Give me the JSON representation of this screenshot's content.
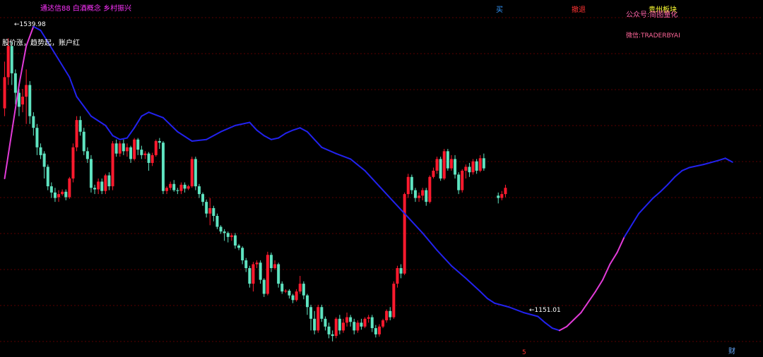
{
  "annotations": {
    "header_tags": "通达信88 白酒概念 乡村振兴",
    "indicator_note": "股价涨，趋势起，账户红",
    "high_label": "1539.98",
    "low_label": "1151.01",
    "buy_marker": "买",
    "withdraw_marker": "撤退",
    "sector": "贵州板块",
    "public_account": "公众号:简图量化",
    "wechat": "微信:TRADERBYAI",
    "bottom_marker_5": "5",
    "bottom_marker_cai": "财"
  },
  "colors": {
    "background": "#000000",
    "up_candle": "#ff1a2e",
    "down_candle": "#5fe3c0",
    "trend_line_blue": "#2222ee",
    "trend_line_magenta": "#e23bd8",
    "grid": "#5a0000"
  },
  "chart_data": {
    "type": "candlestick",
    "y_range": [
      1140,
      1580
    ],
    "high": 1539.98,
    "low": 1151.01,
    "candles": [
      [
        1450,
        1490,
        1510,
        1440
      ],
      [
        1490,
        1530,
        1539.98,
        1480
      ],
      [
        1530,
        1495,
        1535,
        1480
      ],
      [
        1495,
        1470,
        1500,
        1455
      ],
      [
        1470,
        1452,
        1475,
        1440
      ],
      [
        1455,
        1465,
        1475,
        1445
      ],
      [
        1465,
        1480,
        1500,
        1430
      ],
      [
        1480,
        1440,
        1485,
        1430
      ],
      [
        1440,
        1425,
        1445,
        1415
      ],
      [
        1425,
        1400,
        1430,
        1390
      ],
      [
        1400,
        1390,
        1405,
        1385
      ],
      [
        1392,
        1375,
        1395,
        1360
      ],
      [
        1375,
        1350,
        1378,
        1345
      ],
      [
        1350,
        1342,
        1355,
        1335
      ],
      [
        1342,
        1335,
        1348,
        1330
      ],
      [
        1336,
        1340,
        1345,
        1330
      ],
      [
        1340,
        1343,
        1346,
        1338
      ],
      [
        1343,
        1336,
        1346,
        1332
      ],
      [
        1336,
        1360,
        1362,
        1334
      ],
      [
        1360,
        1400,
        1405,
        1355
      ],
      [
        1400,
        1435,
        1440,
        1395
      ],
      [
        1435,
        1420,
        1440,
        1415
      ],
      [
        1420,
        1395,
        1425,
        1390
      ],
      [
        1395,
        1385,
        1400,
        1380
      ],
      [
        1385,
        1348,
        1390,
        1342
      ],
      [
        1348,
        1346,
        1352,
        1340
      ],
      [
        1346,
        1356,
        1360,
        1340
      ],
      [
        1356,
        1344,
        1360,
        1340
      ],
      [
        1344,
        1364,
        1366,
        1340
      ],
      [
        1364,
        1350,
        1368,
        1345
      ],
      [
        1350,
        1405,
        1408,
        1345
      ],
      [
        1405,
        1392,
        1410,
        1388
      ],
      [
        1392,
        1405,
        1408,
        1388
      ],
      [
        1405,
        1395,
        1410,
        1390
      ],
      [
        1395,
        1400,
        1405,
        1388
      ],
      [
        1400,
        1385,
        1402,
        1380
      ],
      [
        1385,
        1410,
        1412,
        1383
      ],
      [
        1410,
        1397,
        1412,
        1390
      ],
      [
        1397,
        1390,
        1402,
        1385
      ],
      [
        1390,
        1392,
        1395,
        1385
      ],
      [
        1392,
        1380,
        1394,
        1370
      ],
      [
        1380,
        1390,
        1393,
        1376
      ],
      [
        1390,
        1408,
        1410,
        1388
      ],
      [
        1408,
        1406,
        1412,
        1398
      ],
      [
        1406,
        1344,
        1408,
        1340
      ],
      [
        1344,
        1348,
        1350,
        1340
      ],
      [
        1348,
        1353,
        1356,
        1345
      ],
      [
        1353,
        1345,
        1358,
        1343
      ],
      [
        1345,
        1344,
        1348,
        1340
      ],
      [
        1344,
        1352,
        1355,
        1340
      ],
      [
        1352,
        1347,
        1355,
        1342
      ],
      [
        1347,
        1350,
        1352,
        1345
      ],
      [
        1350,
        1385,
        1388,
        1348
      ],
      [
        1385,
        1350,
        1388,
        1345
      ],
      [
        1350,
        1340,
        1353,
        1335
      ],
      [
        1340,
        1330,
        1342,
        1325
      ],
      [
        1330,
        1315,
        1333,
        1310
      ],
      [
        1315,
        1322,
        1335,
        1300
      ],
      [
        1322,
        1312,
        1325,
        1305
      ],
      [
        1312,
        1298,
        1315,
        1295
      ],
      [
        1298,
        1292,
        1300,
        1289
      ],
      [
        1292,
        1290,
        1295,
        1280
      ],
      [
        1290,
        1285,
        1292,
        1278
      ],
      [
        1285,
        1287,
        1290,
        1280
      ],
      [
        1287,
        1274,
        1290,
        1270
      ],
      [
        1274,
        1271,
        1276,
        1268
      ],
      [
        1271,
        1255,
        1273,
        1250
      ],
      [
        1255,
        1245,
        1258,
        1240
      ],
      [
        1245,
        1225,
        1248,
        1220
      ],
      [
        1225,
        1250,
        1253,
        1215
      ],
      [
        1250,
        1252,
        1255,
        1245
      ],
      [
        1252,
        1230,
        1255,
        1225
      ],
      [
        1230,
        1212,
        1232,
        1208
      ],
      [
        1212,
        1262,
        1266,
        1210
      ],
      [
        1262,
        1245,
        1265,
        1240
      ],
      [
        1245,
        1250,
        1255,
        1243
      ],
      [
        1250,
        1225,
        1252,
        1220
      ],
      [
        1225,
        1215,
        1228,
        1212
      ],
      [
        1215,
        1216,
        1218,
        1213
      ],
      [
        1216,
        1210,
        1218,
        1206
      ],
      [
        1210,
        1204,
        1212,
        1200
      ],
      [
        1204,
        1215,
        1218,
        1202
      ],
      [
        1215,
        1225,
        1235,
        1212
      ],
      [
        1225,
        1210,
        1228,
        1205
      ],
      [
        1210,
        1195,
        1212,
        1185
      ],
      [
        1195,
        1180,
        1198,
        1165
      ],
      [
        1180,
        1165,
        1190,
        1160
      ],
      [
        1165,
        1195,
        1198,
        1162
      ],
      [
        1195,
        1180,
        1198,
        1176
      ],
      [
        1180,
        1170,
        1183,
        1165
      ],
      [
        1170,
        1160,
        1175,
        1155
      ],
      [
        1160,
        1158,
        1165,
        1151.01
      ],
      [
        1158,
        1180,
        1182,
        1155
      ],
      [
        1180,
        1165,
        1185,
        1160
      ],
      [
        1165,
        1175,
        1180,
        1162
      ],
      [
        1175,
        1182,
        1188,
        1170
      ],
      [
        1182,
        1176,
        1185,
        1170
      ],
      [
        1176,
        1165,
        1180,
        1160
      ],
      [
        1165,
        1175,
        1178,
        1162
      ],
      [
        1175,
        1170,
        1180,
        1166
      ],
      [
        1170,
        1180,
        1182,
        1168
      ],
      [
        1180,
        1182,
        1185,
        1175
      ],
      [
        1182,
        1168,
        1185,
        1163
      ],
      [
        1168,
        1160,
        1172,
        1156
      ],
      [
        1160,
        1170,
        1173,
        1157
      ],
      [
        1170,
        1178,
        1180,
        1168
      ],
      [
        1178,
        1190,
        1192,
        1175
      ],
      [
        1190,
        1182,
        1195,
        1178
      ],
      [
        1182,
        1225,
        1228,
        1180
      ],
      [
        1225,
        1245,
        1248,
        1220
      ],
      [
        1245,
        1238,
        1250,
        1232
      ],
      [
        1238,
        1340,
        1342,
        1236
      ],
      [
        1340,
        1362,
        1366,
        1335
      ],
      [
        1362,
        1345,
        1365,
        1340
      ],
      [
        1345,
        1335,
        1348,
        1330
      ],
      [
        1335,
        1338,
        1342,
        1330
      ],
      [
        1338,
        1345,
        1348,
        1332
      ],
      [
        1345,
        1330,
        1348,
        1325
      ],
      [
        1330,
        1362,
        1364,
        1328
      ],
      [
        1362,
        1370,
        1374,
        1360
      ],
      [
        1370,
        1385,
        1388,
        1366
      ],
      [
        1385,
        1360,
        1388,
        1357
      ],
      [
        1360,
        1395,
        1398,
        1358
      ],
      [
        1395,
        1373,
        1398,
        1370
      ],
      [
        1373,
        1385,
        1390,
        1370
      ],
      [
        1385,
        1365,
        1390,
        1360
      ],
      [
        1365,
        1345,
        1368,
        1340
      ],
      [
        1345,
        1370,
        1372,
        1342
      ],
      [
        1370,
        1375,
        1378,
        1360
      ],
      [
        1375,
        1368,
        1380,
        1362
      ],
      [
        1368,
        1382,
        1385,
        1365
      ],
      [
        1382,
        1370,
        1385,
        1366
      ],
      [
        1370,
        1386,
        1390,
        1368
      ],
      [
        1386,
        1373,
        1392,
        1370
      ],
      null,
      null,
      null,
      [
        1338,
        1335,
        1342,
        1328
      ],
      [
        1335,
        1340,
        1344,
        1332
      ],
      [
        1340,
        1348,
        1352,
        1336
      ]
    ],
    "trend_line": [
      [
        0,
        1360
      ],
      [
        2,
        1420
      ],
      [
        4,
        1480
      ],
      [
        6,
        1530
      ],
      [
        8,
        1555
      ],
      [
        10,
        1550
      ],
      [
        14,
        1520
      ],
      [
        18,
        1490
      ],
      [
        20,
        1465
      ],
      [
        24,
        1440
      ],
      [
        28,
        1428
      ],
      [
        30,
        1415
      ],
      [
        32,
        1410
      ],
      [
        34,
        1412
      ],
      [
        36,
        1425
      ],
      [
        38,
        1440
      ],
      [
        40,
        1445
      ],
      [
        44,
        1438
      ],
      [
        48,
        1420
      ],
      [
        52,
        1408
      ],
      [
        56,
        1410
      ],
      [
        60,
        1420
      ],
      [
        64,
        1428
      ],
      [
        68,
        1432
      ],
      [
        70,
        1422
      ],
      [
        72,
        1415
      ],
      [
        74,
        1410
      ],
      [
        76,
        1412
      ],
      [
        78,
        1418
      ],
      [
        80,
        1422
      ],
      [
        82,
        1425
      ],
      [
        84,
        1420
      ],
      [
        86,
        1410
      ],
      [
        88,
        1400
      ],
      [
        92,
        1392
      ],
      [
        96,
        1385
      ],
      [
        100,
        1370
      ],
      [
        104,
        1350
      ],
      [
        108,
        1330
      ],
      [
        112,
        1310
      ],
      [
        116,
        1290
      ],
      [
        120,
        1268
      ],
      [
        124,
        1248
      ],
      [
        128,
        1232
      ],
      [
        132,
        1215
      ],
      [
        134,
        1206
      ],
      [
        136,
        1200
      ],
      [
        140,
        1195
      ],
      [
        144,
        1188
      ],
      [
        148,
        1183
      ],
      [
        150,
        1175
      ],
      [
        152,
        1168
      ],
      [
        154,
        1165
      ],
      [
        156,
        1170
      ],
      [
        160,
        1188
      ],
      [
        164,
        1215
      ],
      [
        166,
        1230
      ],
      [
        168,
        1250
      ],
      [
        170,
        1265
      ],
      [
        172,
        1285
      ],
      [
        174,
        1300
      ],
      [
        176,
        1315
      ],
      [
        180,
        1335
      ],
      [
        182,
        1343
      ],
      [
        184,
        1352
      ],
      [
        186,
        1362
      ],
      [
        188,
        1370
      ],
      [
        190,
        1374
      ],
      [
        194,
        1378
      ],
      [
        198,
        1383
      ],
      [
        200,
        1386
      ],
      [
        202,
        1381
      ]
    ]
  }
}
